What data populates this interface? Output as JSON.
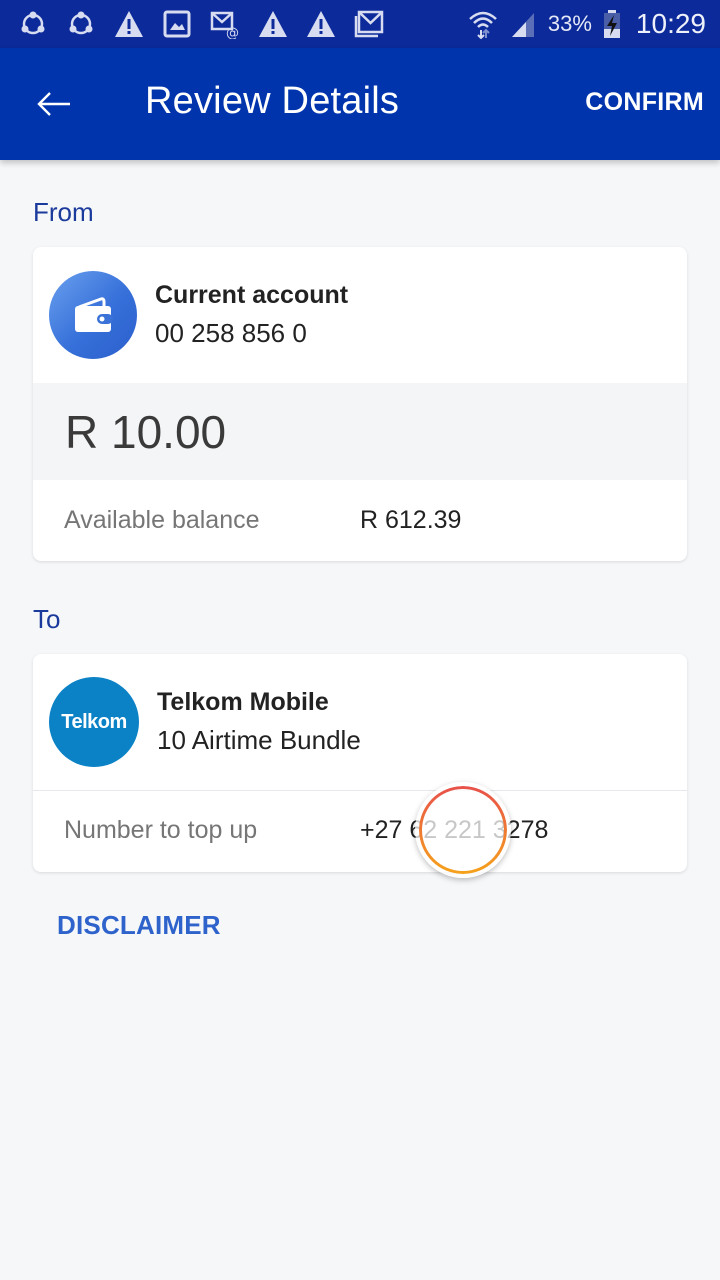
{
  "status_bar": {
    "notification_icons": [
      "shareit-icon",
      "shareit-icon",
      "warning-icon",
      "gallery-icon",
      "email-icon",
      "warning-icon",
      "warning-icon",
      "gmail-icon"
    ],
    "battery_percent": "33%",
    "time": "10:29"
  },
  "app_bar": {
    "title": "Review Details",
    "confirm_label": "CONFIRM",
    "background_color": "#0034ad"
  },
  "from": {
    "section_label": "From",
    "account_name": "Current account",
    "account_number": "00 258 856 0",
    "amount": "R 10.00",
    "available_balance_label": "Available balance",
    "available_balance_value": "R 612.39"
  },
  "to": {
    "section_label": "To",
    "provider_logo_text": "Telkom",
    "provider_name": "Telkom Mobile",
    "product": "10 Airtime Bundle",
    "number_label": "Number to top up",
    "number_value": "+27 62 221 3278"
  },
  "disclaimer_label": "DISCLAIMER",
  "colors": {
    "accent": "#2f63cc",
    "section_label": "#1a3a9c",
    "telkom_brand": "#0b82c6"
  }
}
